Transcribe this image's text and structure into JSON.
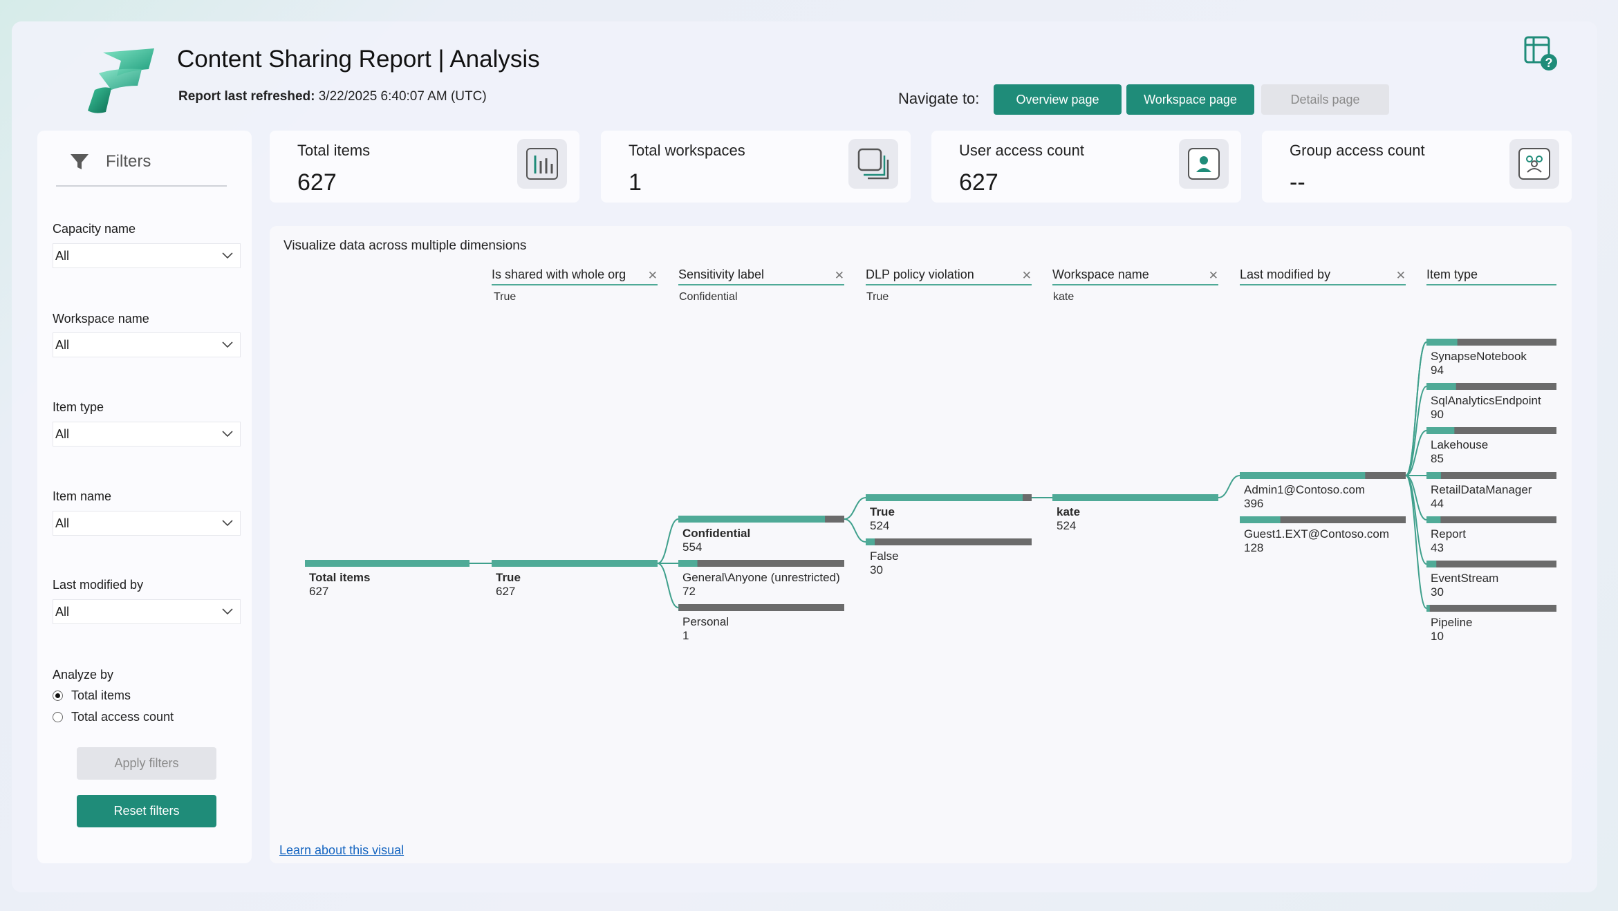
{
  "header": {
    "title": "Content Sharing Report | Analysis",
    "refresh_label": "Report last refreshed:",
    "refresh_value": "3/22/2025 6:40:07 AM (UTC)",
    "nav_label": "Navigate to:",
    "nav_buttons": [
      "Overview page",
      "Workspace page",
      "Details page"
    ]
  },
  "filters": {
    "title": "Filters",
    "fields": [
      {
        "label": "Capacity name",
        "value": "All"
      },
      {
        "label": "Workspace name",
        "value": "All"
      },
      {
        "label": "Item type",
        "value": "All"
      },
      {
        "label": "Item name",
        "value": "All"
      },
      {
        "label": "Last modified by",
        "value": "All"
      }
    ],
    "analyze_by_label": "Analyze by",
    "analyze_options": [
      "Total items",
      "Total access count"
    ],
    "analyze_selected": "Total items",
    "apply_label": "Apply filters",
    "reset_label": "Reset filters"
  },
  "kpis": [
    {
      "label": "Total items",
      "value": "627",
      "icon": "bar-chart-icon"
    },
    {
      "label": "Total workspaces",
      "value": "1",
      "icon": "workspaces-icon"
    },
    {
      "label": "User access count",
      "value": "627",
      "icon": "user-icon"
    },
    {
      "label": "Group access count",
      "value": "--",
      "icon": "group-icon"
    }
  ],
  "visual": {
    "title": "Visualize data across multiple dimensions",
    "learn_link": "Learn about this visual",
    "columns": [
      {
        "name": "Is shared with whole org",
        "filter": "True",
        "closable": true
      },
      {
        "name": "Sensitivity label",
        "filter": "Confidential",
        "closable": true
      },
      {
        "name": "DLP policy violation",
        "filter": "True",
        "closable": true
      },
      {
        "name": "Workspace name",
        "filter": "kate",
        "closable": true
      },
      {
        "name": "Last modified by",
        "filter": "",
        "closable": true
      },
      {
        "name": "Item type",
        "filter": "",
        "closable": false
      }
    ],
    "root": {
      "label": "Total items",
      "value": 627
    },
    "levels": [
      {
        "nodes": [
          {
            "label": "True",
            "value": 627,
            "selected": true
          }
        ]
      },
      {
        "nodes": [
          {
            "label": "Confidential",
            "value": 554,
            "selected": true
          },
          {
            "label": "General\\Anyone (unrestricted)",
            "value": 72,
            "selected": false
          },
          {
            "label": "Personal",
            "value": 1,
            "selected": false
          }
        ]
      },
      {
        "nodes": [
          {
            "label": "True",
            "value": 524,
            "selected": true
          },
          {
            "label": "False",
            "value": 30,
            "selected": false
          }
        ]
      },
      {
        "nodes": [
          {
            "label": "kate",
            "value": 524,
            "selected": true
          }
        ]
      },
      {
        "nodes": [
          {
            "label": "Admin1@Contoso.com",
            "value": 396,
            "selected": false
          },
          {
            "label": "Guest1.EXT@Contoso.com",
            "value": 128,
            "selected": false
          }
        ]
      },
      {
        "nodes": [
          {
            "label": "SynapseNotebook",
            "value": 94,
            "selected": false
          },
          {
            "label": "SqlAnalyticsEndpoint",
            "value": 90,
            "selected": false
          },
          {
            "label": "Lakehouse",
            "value": 85,
            "selected": false
          },
          {
            "label": "RetailDataManager",
            "value": 44,
            "selected": false
          },
          {
            "label": "Report",
            "value": 43,
            "selected": false
          },
          {
            "label": "EventStream",
            "value": 30,
            "selected": false
          },
          {
            "label": "Pipeline",
            "value": 10,
            "selected": false
          }
        ]
      }
    ],
    "colors": {
      "fill": "#4faa97",
      "rest": "#6b6b6b",
      "line": "#3fa08c"
    }
  }
}
